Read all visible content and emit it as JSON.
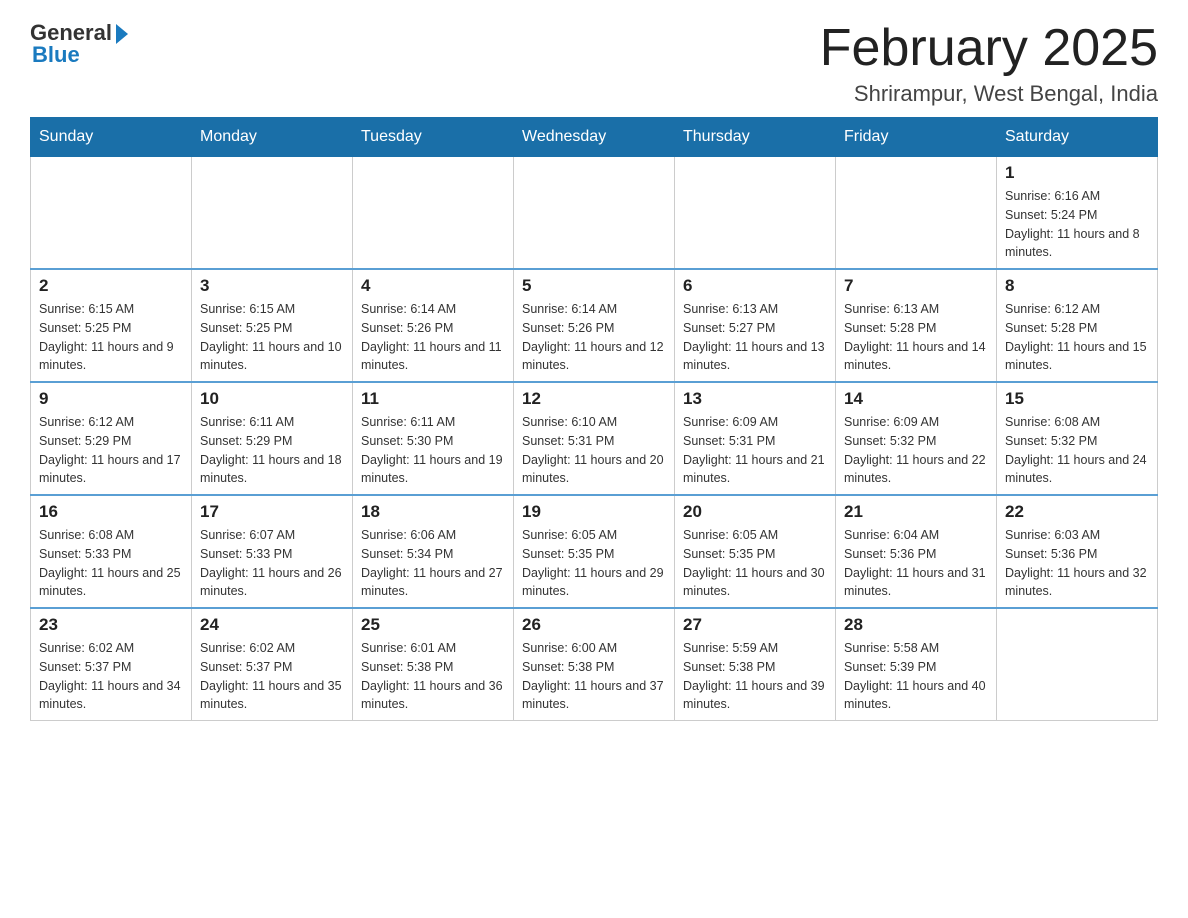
{
  "header": {
    "logo_general": "General",
    "logo_blue": "Blue",
    "month_title": "February 2025",
    "location": "Shrirampur, West Bengal, India"
  },
  "weekdays": [
    "Sunday",
    "Monday",
    "Tuesday",
    "Wednesday",
    "Thursday",
    "Friday",
    "Saturday"
  ],
  "weeks": [
    [
      {
        "day": "",
        "info": ""
      },
      {
        "day": "",
        "info": ""
      },
      {
        "day": "",
        "info": ""
      },
      {
        "day": "",
        "info": ""
      },
      {
        "day": "",
        "info": ""
      },
      {
        "day": "",
        "info": ""
      },
      {
        "day": "1",
        "info": "Sunrise: 6:16 AM\nSunset: 5:24 PM\nDaylight: 11 hours and 8 minutes."
      }
    ],
    [
      {
        "day": "2",
        "info": "Sunrise: 6:15 AM\nSunset: 5:25 PM\nDaylight: 11 hours and 9 minutes."
      },
      {
        "day": "3",
        "info": "Sunrise: 6:15 AM\nSunset: 5:25 PM\nDaylight: 11 hours and 10 minutes."
      },
      {
        "day": "4",
        "info": "Sunrise: 6:14 AM\nSunset: 5:26 PM\nDaylight: 11 hours and 11 minutes."
      },
      {
        "day": "5",
        "info": "Sunrise: 6:14 AM\nSunset: 5:26 PM\nDaylight: 11 hours and 12 minutes."
      },
      {
        "day": "6",
        "info": "Sunrise: 6:13 AM\nSunset: 5:27 PM\nDaylight: 11 hours and 13 minutes."
      },
      {
        "day": "7",
        "info": "Sunrise: 6:13 AM\nSunset: 5:28 PM\nDaylight: 11 hours and 14 minutes."
      },
      {
        "day": "8",
        "info": "Sunrise: 6:12 AM\nSunset: 5:28 PM\nDaylight: 11 hours and 15 minutes."
      }
    ],
    [
      {
        "day": "9",
        "info": "Sunrise: 6:12 AM\nSunset: 5:29 PM\nDaylight: 11 hours and 17 minutes."
      },
      {
        "day": "10",
        "info": "Sunrise: 6:11 AM\nSunset: 5:29 PM\nDaylight: 11 hours and 18 minutes."
      },
      {
        "day": "11",
        "info": "Sunrise: 6:11 AM\nSunset: 5:30 PM\nDaylight: 11 hours and 19 minutes."
      },
      {
        "day": "12",
        "info": "Sunrise: 6:10 AM\nSunset: 5:31 PM\nDaylight: 11 hours and 20 minutes."
      },
      {
        "day": "13",
        "info": "Sunrise: 6:09 AM\nSunset: 5:31 PM\nDaylight: 11 hours and 21 minutes."
      },
      {
        "day": "14",
        "info": "Sunrise: 6:09 AM\nSunset: 5:32 PM\nDaylight: 11 hours and 22 minutes."
      },
      {
        "day": "15",
        "info": "Sunrise: 6:08 AM\nSunset: 5:32 PM\nDaylight: 11 hours and 24 minutes."
      }
    ],
    [
      {
        "day": "16",
        "info": "Sunrise: 6:08 AM\nSunset: 5:33 PM\nDaylight: 11 hours and 25 minutes."
      },
      {
        "day": "17",
        "info": "Sunrise: 6:07 AM\nSunset: 5:33 PM\nDaylight: 11 hours and 26 minutes."
      },
      {
        "day": "18",
        "info": "Sunrise: 6:06 AM\nSunset: 5:34 PM\nDaylight: 11 hours and 27 minutes."
      },
      {
        "day": "19",
        "info": "Sunrise: 6:05 AM\nSunset: 5:35 PM\nDaylight: 11 hours and 29 minutes."
      },
      {
        "day": "20",
        "info": "Sunrise: 6:05 AM\nSunset: 5:35 PM\nDaylight: 11 hours and 30 minutes."
      },
      {
        "day": "21",
        "info": "Sunrise: 6:04 AM\nSunset: 5:36 PM\nDaylight: 11 hours and 31 minutes."
      },
      {
        "day": "22",
        "info": "Sunrise: 6:03 AM\nSunset: 5:36 PM\nDaylight: 11 hours and 32 minutes."
      }
    ],
    [
      {
        "day": "23",
        "info": "Sunrise: 6:02 AM\nSunset: 5:37 PM\nDaylight: 11 hours and 34 minutes."
      },
      {
        "day": "24",
        "info": "Sunrise: 6:02 AM\nSunset: 5:37 PM\nDaylight: 11 hours and 35 minutes."
      },
      {
        "day": "25",
        "info": "Sunrise: 6:01 AM\nSunset: 5:38 PM\nDaylight: 11 hours and 36 minutes."
      },
      {
        "day": "26",
        "info": "Sunrise: 6:00 AM\nSunset: 5:38 PM\nDaylight: 11 hours and 37 minutes."
      },
      {
        "day": "27",
        "info": "Sunrise: 5:59 AM\nSunset: 5:38 PM\nDaylight: 11 hours and 39 minutes."
      },
      {
        "day": "28",
        "info": "Sunrise: 5:58 AM\nSunset: 5:39 PM\nDaylight: 11 hours and 40 minutes."
      },
      {
        "day": "",
        "info": ""
      }
    ]
  ]
}
